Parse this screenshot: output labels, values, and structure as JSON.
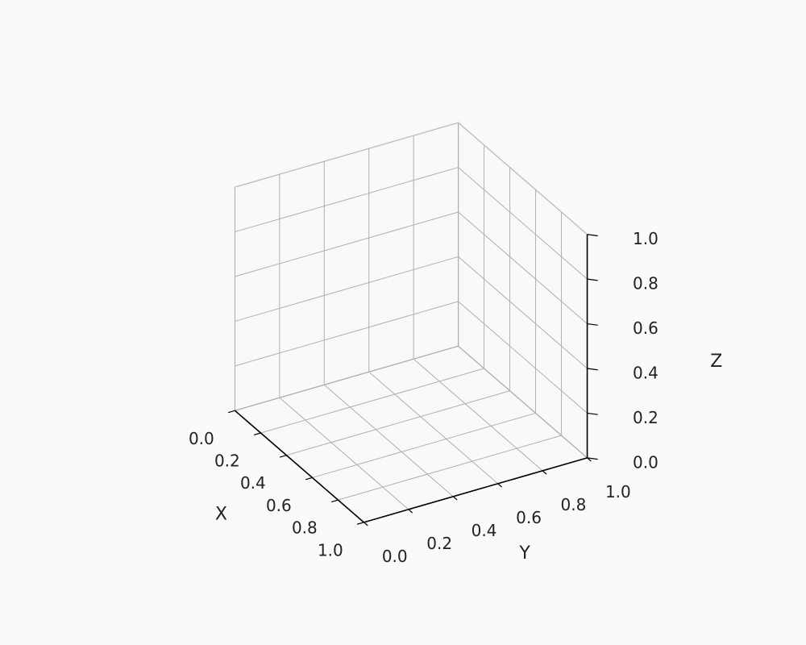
{
  "chart_data": {
    "type": "scatter",
    "is_3d": true,
    "title": "",
    "xlabel": "X",
    "ylabel": "Y",
    "zlabel": "Z",
    "x_ticks": [
      "0.0",
      "0.2",
      "0.4",
      "0.6",
      "0.8",
      "1.0"
    ],
    "y_ticks": [
      "0.0",
      "0.2",
      "0.4",
      "0.6",
      "0.8",
      "1.0"
    ],
    "z_ticks": [
      "0.0",
      "0.2",
      "0.4",
      "0.6",
      "0.8",
      "1.0"
    ],
    "xlim": [
      0.0,
      1.0
    ],
    "ylim": [
      0.0,
      1.0
    ],
    "zlim": [
      0.0,
      1.0
    ],
    "series": []
  },
  "colors": {
    "background": "#fafafa",
    "grid": "#b0b0b0"
  }
}
